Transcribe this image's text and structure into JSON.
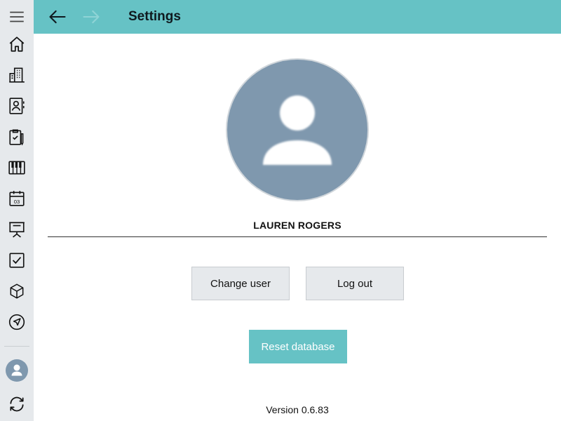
{
  "header": {
    "title": "Settings",
    "back_icon": "arrow-left-icon",
    "forward_icon": "arrow-right-icon"
  },
  "sidebar": {
    "items": [
      {
        "icon": "hamburger-menu-icon"
      },
      {
        "icon": "home-icon"
      },
      {
        "icon": "buildings-icon"
      },
      {
        "icon": "contacts-book-icon"
      },
      {
        "icon": "clipboard-check-icon"
      },
      {
        "icon": "piano-keys-icon"
      },
      {
        "icon": "calendar-icon",
        "calendar_day": "03"
      },
      {
        "icon": "presentation-board-icon"
      },
      {
        "icon": "checkbox-icon"
      },
      {
        "icon": "cube-icon"
      },
      {
        "icon": "navigation-arrow-icon"
      },
      {
        "icon": "user-avatar-icon"
      },
      {
        "icon": "sync-icon"
      }
    ]
  },
  "profile": {
    "name": "LAUREN ROGERS"
  },
  "actions": {
    "change_user_label": "Change user",
    "log_out_label": "Log out",
    "reset_database_label": "Reset database"
  },
  "footer": {
    "version": "Version 0.6.83"
  },
  "colors": {
    "accent": "#66c2c5",
    "sidebar_bg": "#e6e9ec",
    "avatar_bg": "#7f98ae",
    "button_bg": "#e6e9ec"
  }
}
